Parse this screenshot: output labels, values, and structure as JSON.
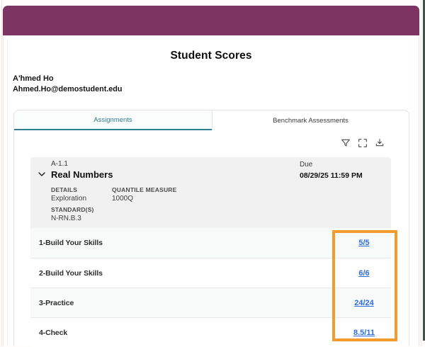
{
  "header": {
    "title": "Student Scores"
  },
  "student": {
    "name": "A'hmed Ho",
    "email": "Ahmed.Ho@demostudent.edu"
  },
  "tabs": {
    "assignments": "Assignments",
    "benchmark": "Benchmark Assessments",
    "active": "Assignments"
  },
  "toolbar": {
    "icons": [
      "filter-icon",
      "fullscreen-icon",
      "download-icon"
    ]
  },
  "assignment": {
    "code": "A-1.1",
    "title": "Real Numbers",
    "due": {
      "label": "Due",
      "value": "08/29/25 11:59 PM"
    },
    "fields": {
      "details": {
        "label": "DETAILS",
        "value": "Exploration"
      },
      "quantile": {
        "label": "QUANTILE MEASURE",
        "value": "1000Q"
      },
      "standards": {
        "label": "STANDARD(S)",
        "value": "N-RN.B.3"
      }
    },
    "items": [
      {
        "label": "1-Build Your Skills",
        "score": "5/5"
      },
      {
        "label": "2-Build Your Skills",
        "score": "6/6"
      },
      {
        "label": "3-Practice",
        "score": "24/24"
      },
      {
        "label": "4-Check",
        "score": "8.5/11"
      }
    ]
  },
  "annotation": {
    "highlight_color": "#F59B2C"
  },
  "colors": {
    "header_bar": "#7D3463",
    "active_tab": "#2E7D91",
    "score_link": "#2C6CE0",
    "card_background": "#F1F1F1",
    "right_strip": "#42544A"
  }
}
